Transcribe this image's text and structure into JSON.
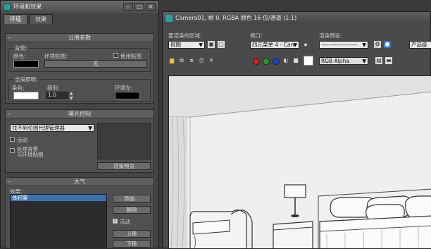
{
  "env_window": {
    "title": "环境和效果",
    "tabs": [
      "环境",
      "效果"
    ],
    "common_params": {
      "header": "公用参数",
      "background_group": "背景:",
      "color_label": "颜色:",
      "env_map_label": "环境贴图:",
      "use_map_label": "使用贴图",
      "map_value": "无",
      "global_lighting_group": "全局照明:",
      "tint_label": "染色:",
      "level_label": "级别:",
      "level_value": "1.0",
      "ambient_label": "环境光:",
      "bg_color": "#000000",
      "tint_color": "#ffffff",
      "ambient_color": "#000000"
    },
    "exposure": {
      "header": "曝光控制",
      "dropdown": "找不到位图代理管理器",
      "active_label": "活动",
      "process_bg_label_1": "处理背景",
      "process_bg_label_2": "与环境贴图",
      "render_preview": "渲染预览"
    },
    "atmosphere": {
      "header": "大气",
      "effects_label": "效果:",
      "selected_effect": "体积雾",
      "add_button": "添加...",
      "delete_button": "删除",
      "active_label": "活动",
      "move_up": "上移",
      "move_down": "下移"
    }
  },
  "frame_window": {
    "title": "Camera01, 帧 0, RGBA 颜色 16 位/通道 (1:1)",
    "area_label": "要渲染的区域:",
    "area_value": "视图",
    "viewport_label": "视口:",
    "viewport_value": "四元菜单 4 - Can",
    "preset_label": "渲染预设:",
    "preset_value": "-------------------",
    "product_label": "产品级",
    "channel_value": "RGB Alpha"
  }
}
